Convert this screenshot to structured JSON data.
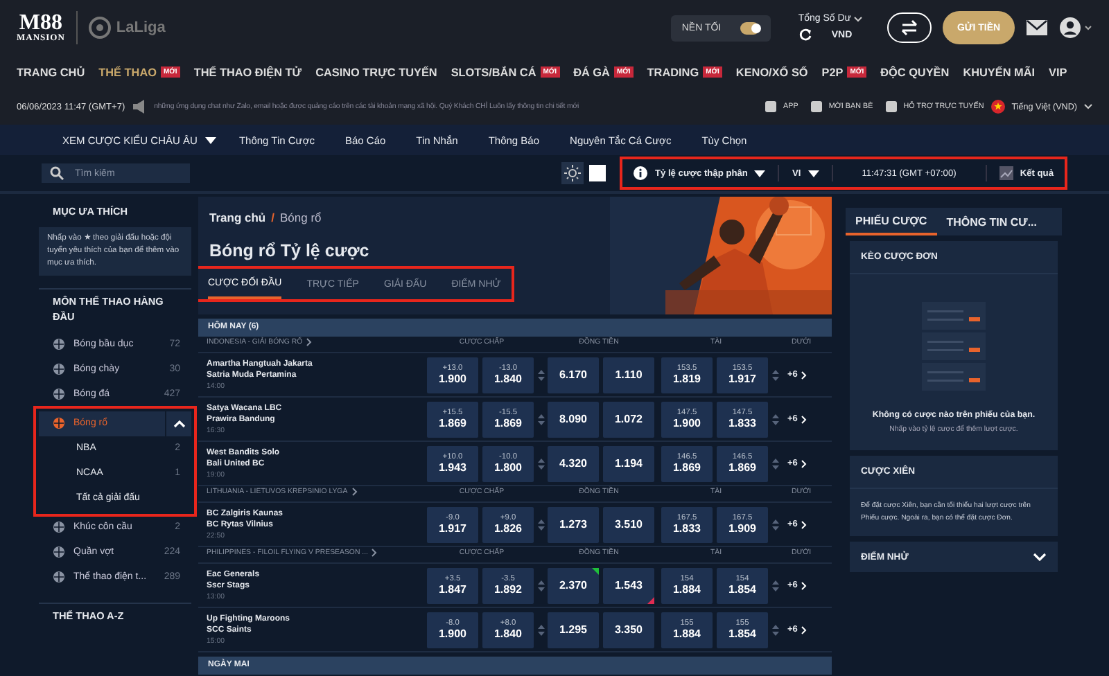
{
  "header": {
    "logo": {
      "top": "M88",
      "bottom": "MANSION",
      "partner": "LaLiga"
    },
    "dark_mode": {
      "label": "NỀN TỐI",
      "on": true
    },
    "balance": {
      "label": "Tổng Số Dư",
      "currency": "VND"
    },
    "deposit_button": "GỬI TIỀN"
  },
  "nav": [
    {
      "label": "TRANG CHỦ",
      "selected": false
    },
    {
      "label": "THỂ THAO",
      "badge": "MỚI",
      "selected": true
    },
    {
      "label": "THỂ THAO ĐIỆN TỬ",
      "selected": false
    },
    {
      "label": "CASINO TRỰC TUYẾN",
      "selected": false
    },
    {
      "label": "SLOTS/BẮN CÁ",
      "badge": "MỚI",
      "selected": false
    },
    {
      "label": "ĐÁ GÀ",
      "badge": "MỚI",
      "selected": false
    },
    {
      "label": "TRADING",
      "badge": "MỚI",
      "selected": false
    },
    {
      "label": "KENO/XỔ SỐ",
      "selected": false
    },
    {
      "label": "P2P",
      "badge": "MỚI",
      "selected": false
    },
    {
      "label": "ĐỘC QUYỀN",
      "selected": false
    },
    {
      "label": "KHUYẾN MÃI",
      "selected": false
    },
    {
      "label": "VIP",
      "selected": false
    }
  ],
  "ticker": {
    "date": "06/06/2023 11:47 (GMT+7)",
    "message": "những ứng dụng chat như Zalo, email hoặc được quảng cáo trên các tài khoản mạng xã hội. Quý Khách CHỈ Luôn lấy thông tin chi tiết mới",
    "links": [
      "APP",
      "MỜI BẠN BÈ",
      "HỖ TRỢ TRỰC TUYẾN"
    ],
    "language": "Tiếng Việt (VND)"
  },
  "subnav": {
    "odds_view": "XEM CƯỢC KIỂU CHÂU ÂU",
    "items": [
      "Thông Tin Cược",
      "Báo Cáo",
      "Tin Nhắn",
      "Thông Báo",
      "Nguyên Tắc Cá Cược",
      "Tùy Chọn"
    ]
  },
  "toolbar": {
    "search_placeholder": "Tìm kiếm",
    "odds_format": "Tỷ lệ cược thập phân",
    "language": "VI",
    "clock": "11:47:31 (GMT +07:00)",
    "results": "Kết quả",
    "highlighted": true
  },
  "sidebar": {
    "favorites": {
      "title": "MỤC ƯA THÍCH",
      "hint": "Nhấp vào ★ theo giải đấu hoặc đội tuyển yêu thích của bạn để thêm vào mục ưa thích."
    },
    "top_sports": {
      "title": "MÔN THỂ THAO HÀNG ĐẦU",
      "items": [
        {
          "label": "Bóng bầu dục",
          "count": "72",
          "selected": false,
          "expanded": false
        },
        {
          "label": "Bóng chày",
          "count": "30",
          "selected": false,
          "expanded": false
        },
        {
          "label": "Bóng đá",
          "count": "427",
          "selected": false,
          "expanded": false
        },
        {
          "label": "Bóng rổ",
          "selected": true,
          "expanded": true,
          "highlighted": true,
          "children": [
            {
              "label": "NBA",
              "count": "2"
            },
            {
              "label": "NCAA",
              "count": "1"
            },
            {
              "label": "Tất cả giải đấu"
            }
          ]
        },
        {
          "label": "Khúc côn cầu",
          "count": "2",
          "selected": false,
          "expanded": false
        },
        {
          "label": "Quần vợt",
          "count": "224",
          "selected": false,
          "expanded": false
        },
        {
          "label": "Thể thao điện t...",
          "count": "289",
          "selected": false,
          "expanded": false
        }
      ]
    },
    "az_title": "THỂ THAO A-Z"
  },
  "main": {
    "breadcrumb": [
      "Trang chủ",
      "Bóng rổ"
    ],
    "breadcrumb_separator": "/",
    "title": "Bóng rổ Tỷ lệ cược",
    "tabs_highlighted": true,
    "tabs": [
      {
        "label": "CƯỢC ĐỐI ĐẦU",
        "selected": true
      },
      {
        "label": "TRỰC TIẾP",
        "selected": false
      },
      {
        "label": "GIẢI ĐẤU",
        "selected": false
      },
      {
        "label": "ĐIỂM NHỬ",
        "selected": false
      }
    ],
    "sections": [
      {
        "title": "HÔM NAY (6)",
        "leagues": [
          {
            "name": "INDONESIA - GIẢI BÓNG RỔ",
            "columns": [
              "CƯỢC CHẤP",
              "ĐỒNG TIỀN",
              "TÀI",
              "DƯỚI"
            ],
            "matches": [
              {
                "home": "Amartha Hangtuah Jakarta",
                "away": "Satria Muda Pertamina",
                "time": "14:00",
                "handicap": [
                  {
                    "line": "+13.0",
                    "odds": "1.900"
                  },
                  {
                    "line": "-13.0",
                    "odds": "1.840"
                  }
                ],
                "moneyline": [
                  {
                    "odds": "6.170",
                    "rising": false,
                    "falling": false
                  },
                  {
                    "odds": "1.110",
                    "rising": false,
                    "falling": false
                  }
                ],
                "totals": [
                  {
                    "line": "153.5",
                    "odds": "1.819"
                  },
                  {
                    "line": "153.5",
                    "odds": "1.917"
                  }
                ],
                "more": "+6"
              },
              {
                "home": "Satya Wacana LBC",
                "away": "Prawira Bandung",
                "time": "16:30",
                "handicap": [
                  {
                    "line": "+15.5",
                    "odds": "1.869"
                  },
                  {
                    "line": "-15.5",
                    "odds": "1.869"
                  }
                ],
                "moneyline": [
                  {
                    "odds": "8.090",
                    "rising": false,
                    "falling": false
                  },
                  {
                    "odds": "1.072",
                    "rising": false,
                    "falling": false
                  }
                ],
                "totals": [
                  {
                    "line": "147.5",
                    "odds": "1.900"
                  },
                  {
                    "line": "147.5",
                    "odds": "1.833"
                  }
                ],
                "more": "+6"
              },
              {
                "home": "West Bandits Solo",
                "away": "Bali United BC",
                "time": "19:00",
                "handicap": [
                  {
                    "line": "+10.0",
                    "odds": "1.943"
                  },
                  {
                    "line": "-10.0",
                    "odds": "1.800"
                  }
                ],
                "moneyline": [
                  {
                    "odds": "4.320",
                    "rising": false,
                    "falling": false
                  },
                  {
                    "odds": "1.194",
                    "rising": false,
                    "falling": false
                  }
                ],
                "totals": [
                  {
                    "line": "146.5",
                    "odds": "1.869"
                  },
                  {
                    "line": "146.5",
                    "odds": "1.869"
                  }
                ],
                "more": "+6"
              }
            ]
          },
          {
            "name": "LITHUANIA - LIETUVOS KREPSINIO LYGA",
            "columns": [
              "CƯỢC CHẤP",
              "ĐỒNG TIỀN",
              "TÀI",
              "DƯỚI"
            ],
            "matches": [
              {
                "home": "BC Zalgiris Kaunas",
                "away": "BC Rytas Vilnius",
                "time": "22:50",
                "handicap": [
                  {
                    "line": "-9.0",
                    "odds": "1.917"
                  },
                  {
                    "line": "+9.0",
                    "odds": "1.826"
                  }
                ],
                "moneyline": [
                  {
                    "odds": "1.273",
                    "rising": false,
                    "falling": false
                  },
                  {
                    "odds": "3.510",
                    "rising": false,
                    "falling": false
                  }
                ],
                "totals": [
                  {
                    "line": "167.5",
                    "odds": "1.833"
                  },
                  {
                    "line": "167.5",
                    "odds": "1.909"
                  }
                ],
                "more": "+6"
              }
            ]
          },
          {
            "name": "PHILIPPINES - FILOIL FLYING V PRESEASON ...",
            "columns": [
              "CƯỢC CHẤP",
              "ĐỒNG TIỀN",
              "TÀI",
              "DƯỚI"
            ],
            "matches": [
              {
                "home": "Eac Generals",
                "away": "Sscr Stags",
                "time": "13:00",
                "handicap": [
                  {
                    "line": "+3.5",
                    "odds": "1.847"
                  },
                  {
                    "line": "-3.5",
                    "odds": "1.892"
                  }
                ],
                "moneyline": [
                  {
                    "odds": "2.370",
                    "rising": true,
                    "falling": false
                  },
                  {
                    "odds": "1.543",
                    "rising": false,
                    "falling": true
                  }
                ],
                "totals": [
                  {
                    "line": "154",
                    "odds": "1.884"
                  },
                  {
                    "line": "154",
                    "odds": "1.854"
                  }
                ],
                "more": "+6"
              },
              {
                "home": "Up Fighting Maroons",
                "away": "SCC Saints",
                "time": "15:00",
                "handicap": [
                  {
                    "line": "-8.0",
                    "odds": "1.900"
                  },
                  {
                    "line": "+8.0",
                    "odds": "1.840"
                  }
                ],
                "moneyline": [
                  {
                    "odds": "1.295",
                    "rising": false,
                    "falling": false
                  },
                  {
                    "odds": "3.350",
                    "rising": false,
                    "falling": false
                  }
                ],
                "totals": [
                  {
                    "line": "155",
                    "odds": "1.884"
                  },
                  {
                    "line": "155",
                    "odds": "1.854"
                  }
                ],
                "more": "+6"
              }
            ]
          }
        ]
      },
      {
        "title": "NGÀY MAI"
      }
    ]
  },
  "betslip": {
    "tabs": [
      {
        "label": "PHIẾU CƯỢC",
        "selected": true
      },
      {
        "label": "THÔNG TIN CƯ...",
        "selected": false
      }
    ],
    "single": {
      "title": "KÈO CƯỢC ĐƠN",
      "empty_title": "Không có cược nào trên phiếu của bạn.",
      "empty_hint": "Nhấp vào tỷ lệ cược để thêm lượt cược."
    },
    "parlay": {
      "title": "CƯỢC XIÊN",
      "text": "Để đặt cược Xiên, bạn cần tối thiểu hai lượt cược trên Phiếu cược. Ngoài ra, bạn có thể đặt cược Đơn."
    },
    "teasers": {
      "title": "ĐIỂM NHỬ",
      "expanded": false
    }
  }
}
